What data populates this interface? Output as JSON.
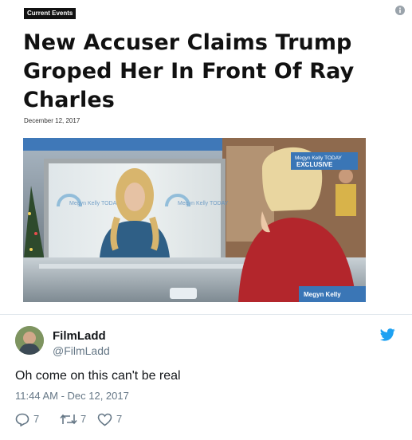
{
  "article": {
    "category": "Current Events",
    "headline": "New Accuser Claims Trump Groped Her In Front Of Ray Charles",
    "date": "December 12, 2017",
    "video_overlay": {
      "screen_logo": "Megyn Kelly TODAY",
      "exclusive_label": "Megyn Kelly TODAY",
      "exclusive_text": "EXCLUSIVE",
      "corner_logo": "Megyn Kelly"
    }
  },
  "tweet": {
    "name": "FilmLadd",
    "handle": "@FilmLadd",
    "text": "Oh come on this can't be real",
    "timestamp": "11:44 AM - Dec 12, 2017",
    "replies": "7",
    "retweets": "7",
    "likes": "7"
  },
  "colors": {
    "twitter_blue": "#1da1f2",
    "muted_gray": "#657786",
    "badge_bg": "#111111"
  },
  "icons": [
    "info-icon",
    "twitter-bird-icon",
    "reply-icon",
    "retweet-icon",
    "like-icon"
  ]
}
